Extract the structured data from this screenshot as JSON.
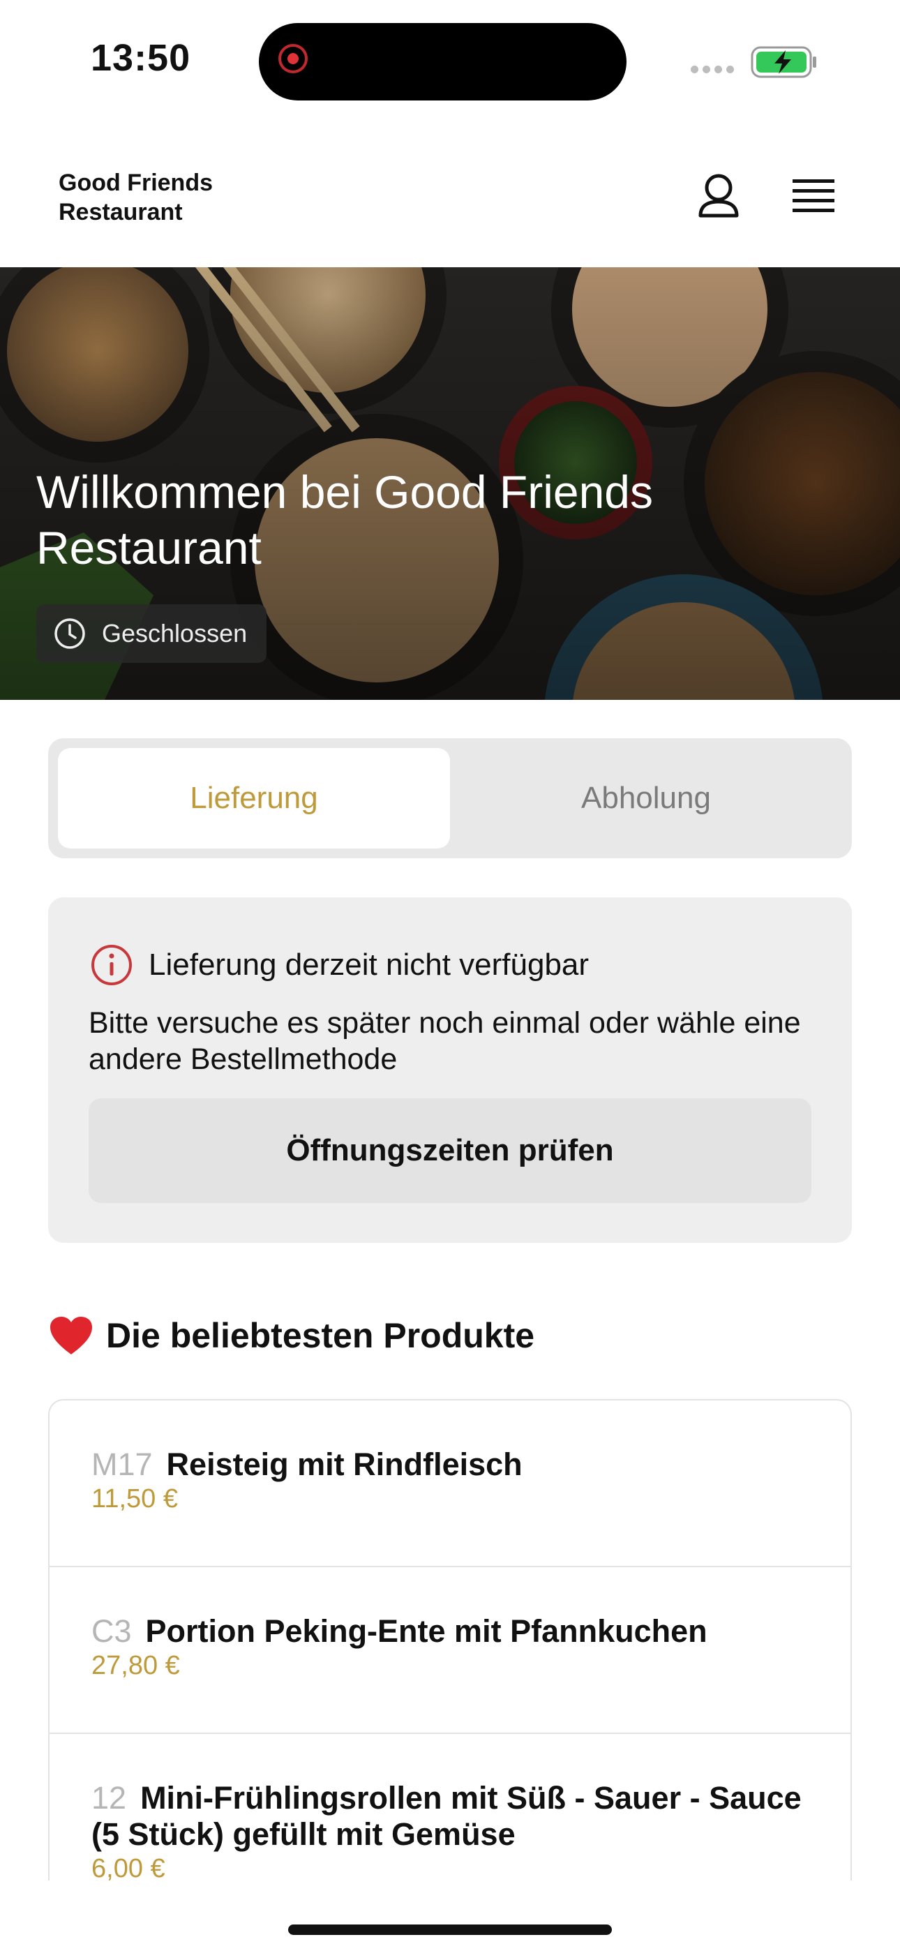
{
  "status_bar": {
    "time": "13:50"
  },
  "header": {
    "brand_line1": "Good Friends",
    "brand_line2": "Restaurant"
  },
  "hero": {
    "title": "Willkommen bei Good Friends Restaurant",
    "status": "Geschlossen"
  },
  "order_mode": {
    "options": [
      "Lieferung",
      "Abholung"
    ],
    "selected": "Lieferung",
    "accent": "#bf9a3b"
  },
  "notice": {
    "title": "Lieferung derzeit nicht verfügbar",
    "text": "Bitte versuche es später noch einmal oder wähle eine andere Bestellmethode",
    "button": "Öffnungszeiten prüfen"
  },
  "popular": {
    "title": "Die beliebtesten Produkte",
    "items": [
      {
        "code": "M17",
        "name": "Reisteig mit Rindfleisch",
        "price": "11,50 €"
      },
      {
        "code": "C3",
        "name": "Portion Peking-Ente mit Pfannkuchen",
        "price": "27,80 €"
      },
      {
        "code": "12",
        "name": "Mini-Frühlingsrollen mit Süß - Sauer - Sauce (5 Stück) gefüllt mit Gemüse",
        "price": "6,00 €"
      }
    ]
  }
}
